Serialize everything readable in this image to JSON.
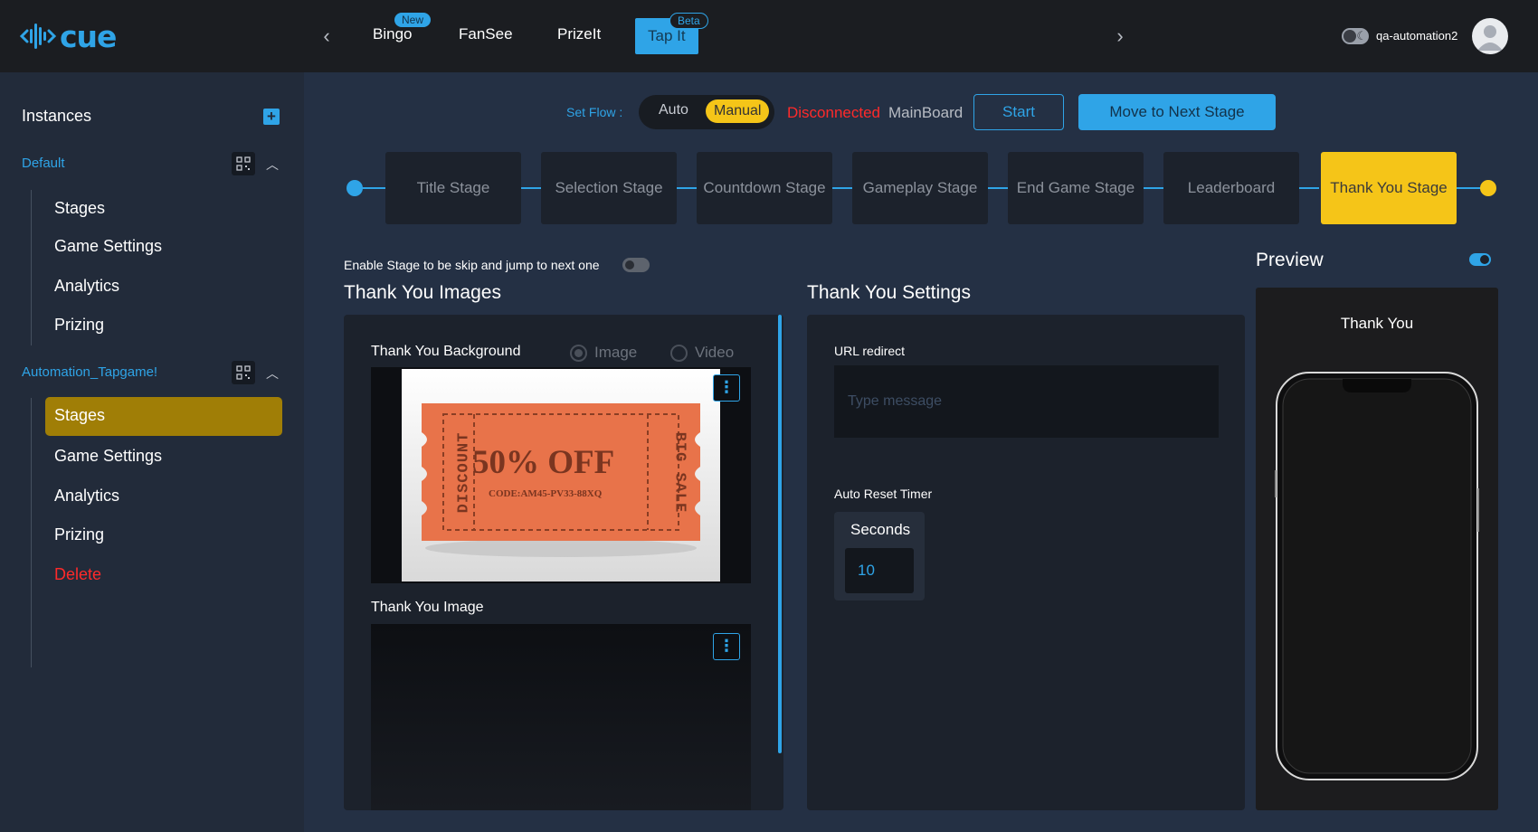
{
  "header": {
    "logo_text": "cue",
    "tabs": [
      {
        "label": "Bingo",
        "badge": "New"
      },
      {
        "label": "FanSee",
        "badge": ""
      },
      {
        "label": "PrizeIt",
        "badge": ""
      },
      {
        "label": "Tap It",
        "badge": "Beta",
        "active": true
      }
    ],
    "username": "qa-automation2"
  },
  "sidebar": {
    "title": "Instances",
    "instances": [
      {
        "name": "Default",
        "items": [
          "Stages",
          "Game Settings",
          "Analytics",
          "Prizing"
        ]
      },
      {
        "name": "Automation_Tapgame!",
        "items": [
          "Stages",
          "Game Settings",
          "Analytics",
          "Prizing",
          "Delete"
        ],
        "active_item": "Stages"
      }
    ]
  },
  "flow": {
    "label": "Set Flow :",
    "auto": "Auto",
    "manual": "Manual",
    "selected": "Manual",
    "status": "Disconnected",
    "board": "MainBoard",
    "start_label": "Start",
    "next_label": "Move to Next Stage"
  },
  "stages": [
    "Title Stage",
    "Selection Stage",
    "Countdown Stage",
    "Gameplay Stage",
    "End Game Stage",
    "Leaderboard",
    "Thank You Stage"
  ],
  "active_stage": "Thank You Stage",
  "skip_label": "Enable Stage to be skip and jump to next one",
  "images": {
    "heading": "Thank You Images",
    "background_label": "Thank You Background",
    "radio_image": "Image",
    "radio_video": "Video",
    "ticket": {
      "side_left": "DISCOUNT",
      "main": "50% OFF",
      "code": "CODE:AM45-PV33-88XQ",
      "side_right": "BIG SALE"
    },
    "image_label": "Thank You Image"
  },
  "settings": {
    "heading": "Thank You Settings",
    "url_label": "URL redirect",
    "url_placeholder": "Type message",
    "timer_label": "Auto Reset Timer",
    "seconds_label": "Seconds",
    "seconds_value": "10"
  },
  "preview": {
    "heading": "Preview",
    "title": "Thank You"
  },
  "colors": {
    "accent": "#2fa4e7",
    "highlight": "#f5c518",
    "danger": "#ff2a2a",
    "active_sidebar": "#a07e06"
  }
}
